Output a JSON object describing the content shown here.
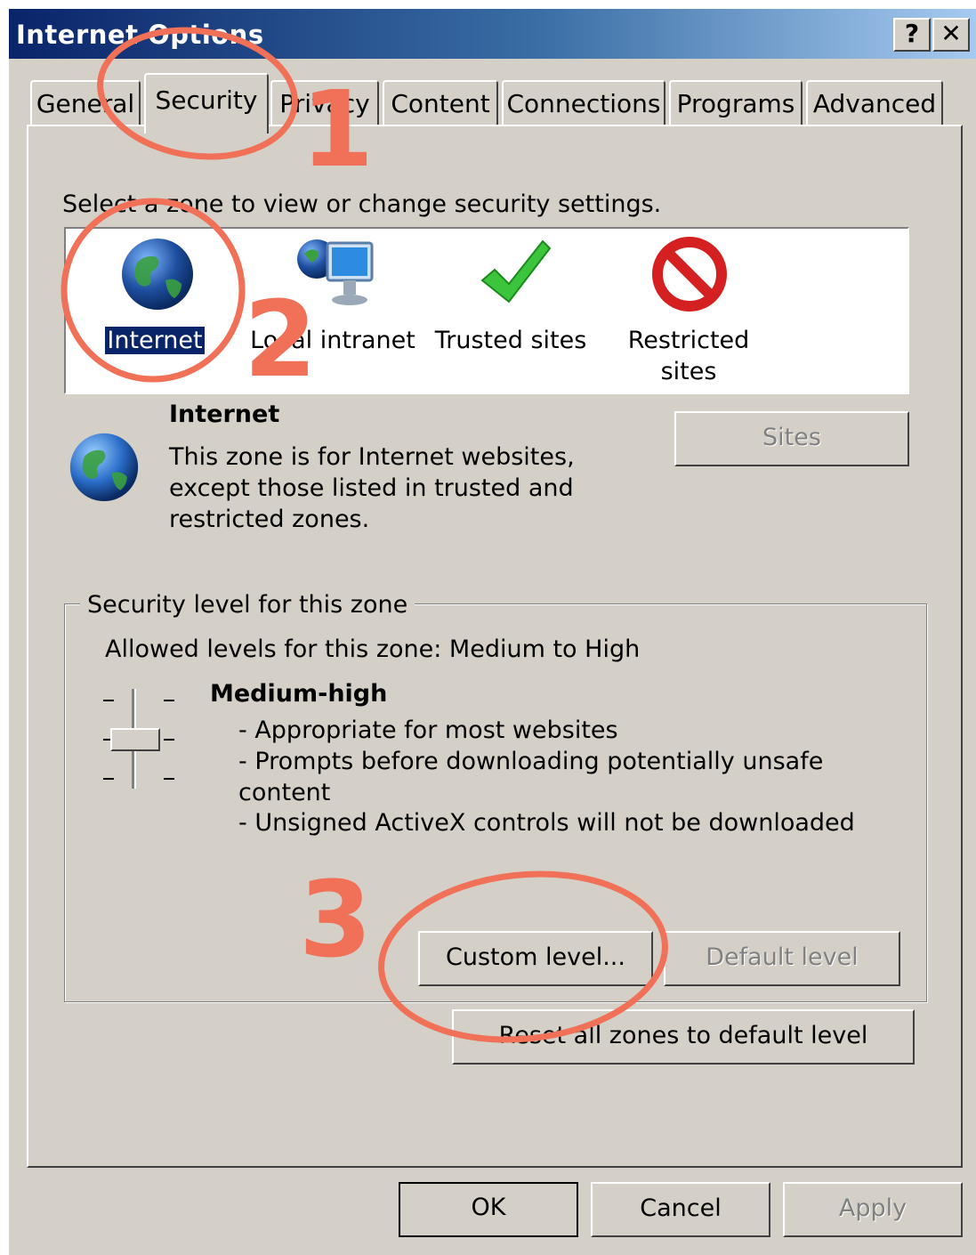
{
  "window": {
    "title": "Internet Options",
    "help_button": "?",
    "close_button": "✕"
  },
  "tabs": [
    "General",
    "Security",
    "Privacy",
    "Content",
    "Connections",
    "Programs",
    "Advanced"
  ],
  "active_tab": "Security",
  "security": {
    "select_zone_prompt": "Select a zone to view or change security settings.",
    "zones": [
      {
        "label": "Internet",
        "icon": "globe-icon",
        "selected": true
      },
      {
        "label": "Local intranet",
        "icon": "intranet-icon",
        "selected": false
      },
      {
        "label": "Trusted sites",
        "icon": "checkmark-icon",
        "selected": false
      },
      {
        "label_line1": "Restricted",
        "label_line2": "sites",
        "icon": "restricted-icon",
        "selected": false
      }
    ],
    "zone_info": {
      "title": "Internet",
      "desc_line1": "This zone is for Internet websites,",
      "desc_line2": "except those listed in trusted and",
      "desc_line3": "restricted zones."
    },
    "sites_button": "Sites",
    "level_group": {
      "legend": "Security level for this zone",
      "allowed_levels": "Allowed levels for this zone: Medium to High",
      "level_name": "Medium-high",
      "bullet1": "- Appropriate for most websites",
      "bullet2a": "- Prompts before downloading potentially unsafe",
      "bullet2b": "content",
      "bullet3": "- Unsigned ActiveX controls will not be downloaded",
      "custom_level_button": "Custom level...",
      "default_level_button": "Default level"
    },
    "reset_all_button": "Reset all zones to default level"
  },
  "footer": {
    "ok": "OK",
    "cancel": "Cancel",
    "apply": "Apply"
  },
  "annotations": {
    "step1": "1",
    "step2": "2",
    "step3": "3",
    "color": "#f07058"
  }
}
